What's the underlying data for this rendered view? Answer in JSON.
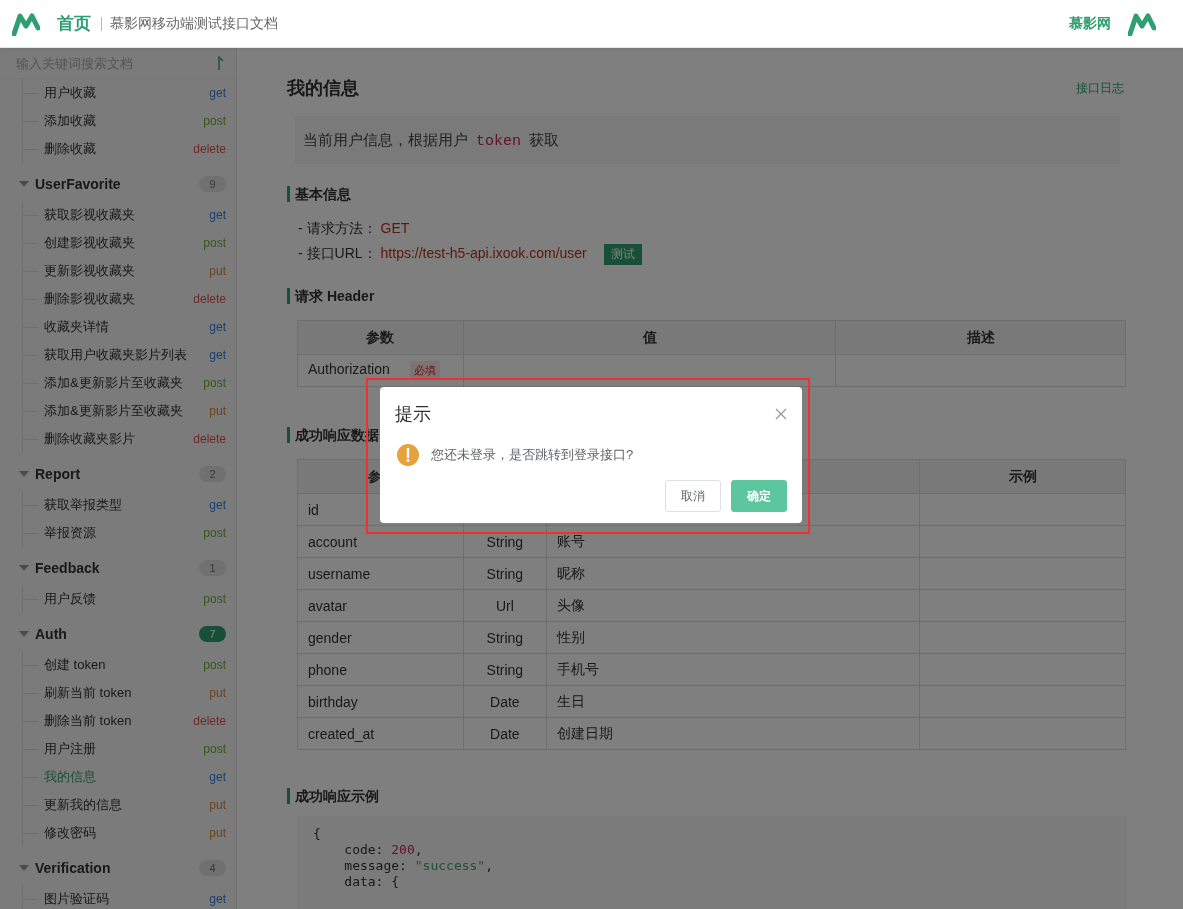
{
  "header": {
    "title": "首页",
    "subtitle": "慕影网移动端测试接口文档",
    "brand": "慕影网"
  },
  "sidebar": {
    "search": {
      "placeholder": "输入关键词搜索文档"
    },
    "groups": [
      {
        "items": [
          {
            "label": "用户收藏",
            "method": "get",
            "selected": false
          },
          {
            "label": "添加收藏",
            "method": "post",
            "selected": false
          },
          {
            "label": "删除收藏",
            "method": "delete",
            "selected": false
          }
        ]
      },
      {
        "name": "UserFavorite",
        "count": "9",
        "expanded": true,
        "selected": false,
        "items": [
          {
            "label": "获取影视收藏夹",
            "method": "get",
            "selected": false
          },
          {
            "label": "创建影视收藏夹",
            "method": "post",
            "selected": false
          },
          {
            "label": "更新影视收藏夹",
            "method": "put",
            "selected": false
          },
          {
            "label": "删除影视收藏夹",
            "method": "delete",
            "selected": false
          },
          {
            "label": "收藏夹详情",
            "method": "get",
            "selected": false
          },
          {
            "label": "获取用户收藏夹影片列表",
            "method": "get",
            "selected": false
          },
          {
            "label": "添加&更新影片至收藏夹",
            "method": "post",
            "selected": false
          },
          {
            "label": "添加&更新影片至收藏夹",
            "method": "put",
            "selected": false
          },
          {
            "label": "删除收藏夹影片",
            "method": "delete",
            "selected": false
          }
        ]
      },
      {
        "name": "Report",
        "count": "2",
        "expanded": true,
        "selected": false,
        "items": [
          {
            "label": "获取举报类型",
            "method": "get",
            "selected": false
          },
          {
            "label": "举报资源",
            "method": "post",
            "selected": false
          }
        ]
      },
      {
        "name": "Feedback",
        "count": "1",
        "expanded": true,
        "selected": false,
        "items": [
          {
            "label": "用户反馈",
            "method": "post",
            "selected": false
          }
        ]
      },
      {
        "name": "Auth",
        "count": "7",
        "expanded": true,
        "selected": true,
        "items": [
          {
            "label": "创建 token",
            "method": "post",
            "selected": false
          },
          {
            "label": "刷新当前 token",
            "method": "put",
            "selected": false
          },
          {
            "label": "删除当前 token",
            "method": "delete",
            "selected": false
          },
          {
            "label": "用户注册",
            "method": "post",
            "selected": false
          },
          {
            "label": "我的信息",
            "method": "get",
            "selected": true
          },
          {
            "label": "更新我的信息",
            "method": "put",
            "selected": false
          },
          {
            "label": "修改密码",
            "method": "put",
            "selected": false
          }
        ]
      },
      {
        "name": "Verification",
        "count": "4",
        "expanded": true,
        "selected": false,
        "items": [
          {
            "label": "图片验证码",
            "method": "get",
            "selected": false
          }
        ]
      }
    ]
  },
  "content": {
    "title": "我的信息",
    "log_link": "接口日志",
    "description": {
      "before": "当前用户信息，根据用户",
      "code": "token",
      "after": "获取"
    },
    "basic_info": {
      "heading": "基本信息",
      "method_label": "- 请求方法：",
      "method": "GET",
      "url_label": "- 接口URL：",
      "url": "https://test-h5-api.ixook.com/user",
      "test_button": "测试"
    },
    "request_header": {
      "heading": "请求 Header",
      "columns": [
        "参数",
        "值",
        "描述"
      ],
      "rows": [
        {
          "param": "Authorization",
          "required_tag": "必填"
        }
      ]
    },
    "response_data": {
      "heading": "成功响应数据",
      "columns": {
        "column_1": "参",
        "column_4": "示例"
      },
      "rows": [
        {
          "name": "id"
        },
        {
          "name": "account",
          "type": "String",
          "desc": "账号"
        },
        {
          "name": "username",
          "type": "String",
          "desc": "昵称"
        },
        {
          "name": "avatar",
          "type": "Url",
          "desc": "头像"
        },
        {
          "name": "gender",
          "type": "String",
          "desc": "性别"
        },
        {
          "name": "phone",
          "type": "String",
          "desc": "手机号"
        },
        {
          "name": "birthday",
          "type": "Date",
          "desc": "生日"
        },
        {
          "name": "created_at",
          "type": "Date",
          "desc": "创建日期"
        }
      ]
    },
    "response_example": {
      "heading": "成功响应示例",
      "lines": [
        {
          "kind": "plain",
          "text": "{"
        },
        {
          "kind": "number",
          "key": "code:",
          "value": "200",
          "tail": ","
        },
        {
          "kind": "string",
          "key": "message:",
          "value": "\"success\"",
          "tail": ","
        },
        {
          "kind": "plain",
          "key": "data:",
          "text": "{"
        }
      ]
    }
  },
  "dialog": {
    "modal": true,
    "highlighted": true,
    "title": "提示",
    "message": "您还未登录，是否跳转到登录接口?",
    "buttons": [
      {
        "label": "取消",
        "kind": "default"
      },
      {
        "label": "确定",
        "kind": "primary"
      }
    ]
  }
}
